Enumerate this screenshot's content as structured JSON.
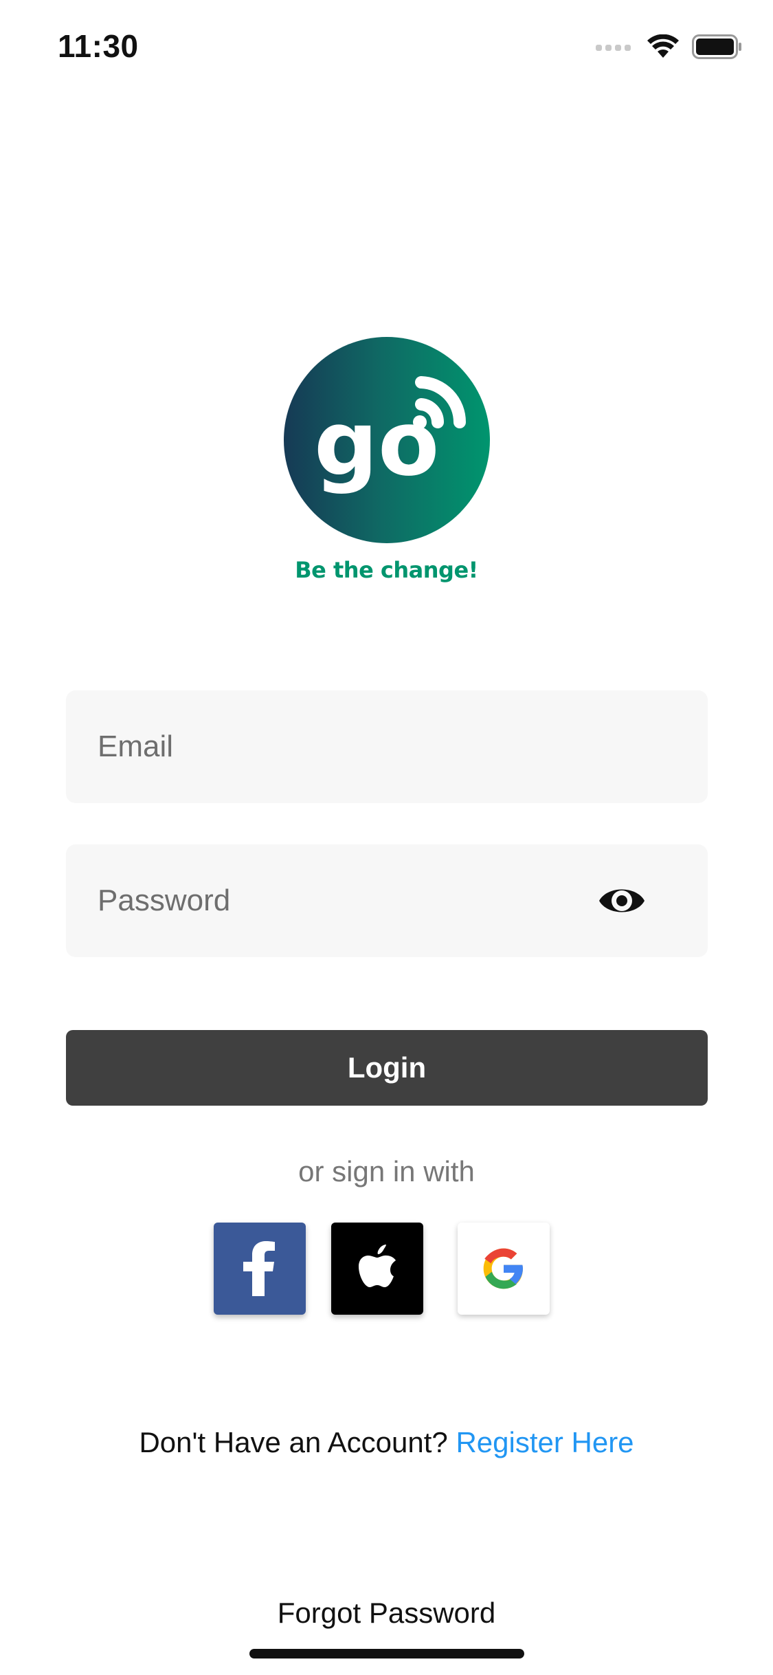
{
  "status_bar": {
    "time": "11:30",
    "icons": [
      "signal-icon",
      "wifi-icon",
      "battery-icon"
    ]
  },
  "logo": {
    "wordmark": "go",
    "tagline": "Be the change!",
    "gradient_colors": [
      "#163a55",
      "#00956e"
    ]
  },
  "form": {
    "email_placeholder": "Email",
    "email_value": "",
    "password_placeholder": "Password",
    "password_value": "",
    "password_toggle_icon": "eye-icon",
    "login_label": "Login"
  },
  "social": {
    "divider_text": "or sign in with",
    "buttons": [
      {
        "name": "facebook",
        "icon": "facebook-icon",
        "color": "#3b5998"
      },
      {
        "name": "apple",
        "icon": "apple-icon",
        "color": "#000000"
      },
      {
        "name": "google",
        "icon": "google-icon",
        "color": "#ffffff"
      }
    ]
  },
  "register": {
    "prompt": "Don't Have an Account?",
    "link": "Register Here",
    "link_color": "#2196f3"
  },
  "forgot_password": "Forgot Password"
}
